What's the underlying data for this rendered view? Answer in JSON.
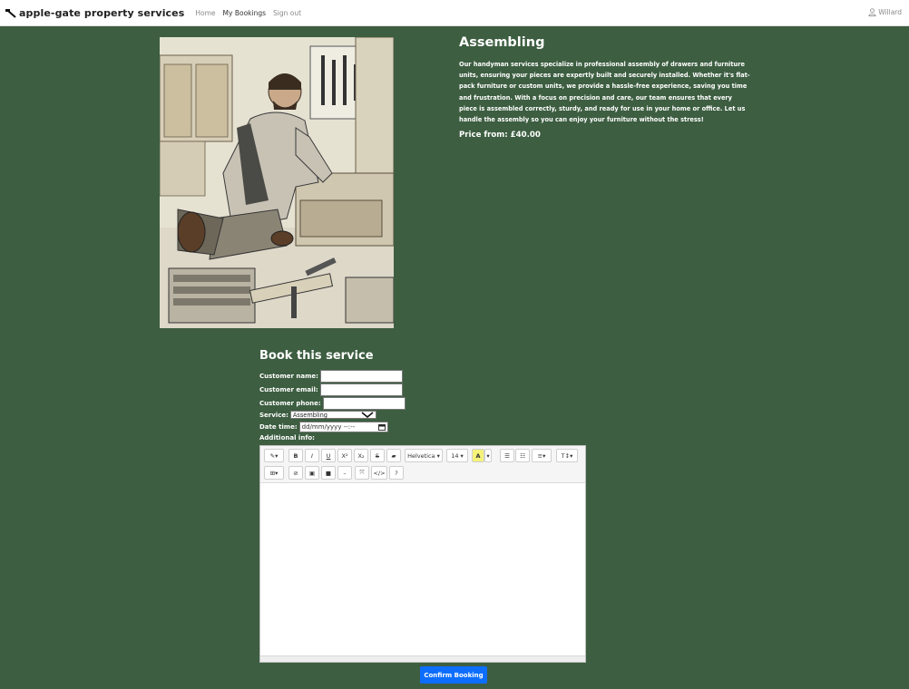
{
  "navbar": {
    "brand": "apple-gate property services",
    "links": [
      "Home",
      "My Bookings",
      "Sign out"
    ],
    "user": "Willard",
    "brand_icon": "hammer-icon",
    "user_icon": "user-icon"
  },
  "service": {
    "title": "Assembling",
    "description": "Our handyman services specialize in professional assembly of drawers and furniture units, ensuring your pieces are expertly built and securely installed. Whether it's flat-pack furniture or custom units, we provide a hassle-free experience, saving you time and frustration. With a focus on precision and care, our team ensures that every piece is assembled correctly, sturdy, and ready for use in your home or office. Let us handle the assembly so you can enjoy your furniture without the stress!",
    "price": "Price from: £40.00"
  },
  "booking": {
    "title": "Book this service",
    "labels": {
      "name": "Customer name:",
      "email": "Customer email:",
      "phone": "Customer phone:",
      "service": "Service:",
      "datetime": "Date time:",
      "info": "Additional info:"
    },
    "service_selected": "Assembling",
    "datetime_placeholder": "dd/mm/yyyy --:--",
    "confirm": "Confirm Booking"
  },
  "editor": {
    "font_family": "Helvetica",
    "font_size": "14",
    "toolbar_icons": [
      "magic-icon",
      "bold-icon",
      "italic-icon",
      "underline-icon",
      "superscript-icon",
      "subscript-icon",
      "strikethrough-icon",
      "eraser-icon",
      "font-family-select",
      "font-size-select",
      "text-color-icon",
      "unordered-list-icon",
      "ordered-list-icon",
      "align-icon",
      "line-height-icon",
      "table-icon",
      "link-icon",
      "image-icon",
      "video-icon",
      "hr-icon",
      "fullscreen-icon",
      "code-view-icon",
      "help-icon"
    ]
  },
  "colors": {
    "background": "#3d5e41",
    "primary": "#0d6efd",
    "highlight": "#f5f27a"
  }
}
